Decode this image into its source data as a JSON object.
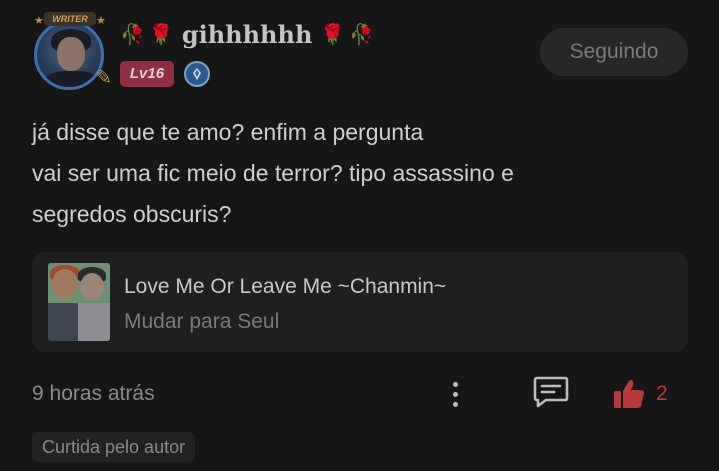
{
  "author": {
    "avatar_badge": "WRITER",
    "username": "gihhhhhh",
    "decorations": [
      "wilted-rose",
      "rose",
      "rose",
      "wilted-rose"
    ],
    "level": "Lv16",
    "title_icon": "shield-icon"
  },
  "follow_button": {
    "label": "Seguindo"
  },
  "comment": {
    "lines": [
      "já disse que te amo? enfim a pergunta",
      "vai ser uma fic meio de terror? tipo assassino e",
      "segredos obscuris?"
    ]
  },
  "story": {
    "title": "Love Me Or Leave Me ~Chanmin~",
    "subtitle": "Mudar para Seul"
  },
  "footer": {
    "timestamp": "9 horas atrás",
    "like_count": "2",
    "liked_by_author": "Curtida pelo autor"
  },
  "colors": {
    "background": "#161616",
    "like_accent": "#b8383f",
    "level_badge": "#8f2f41"
  }
}
